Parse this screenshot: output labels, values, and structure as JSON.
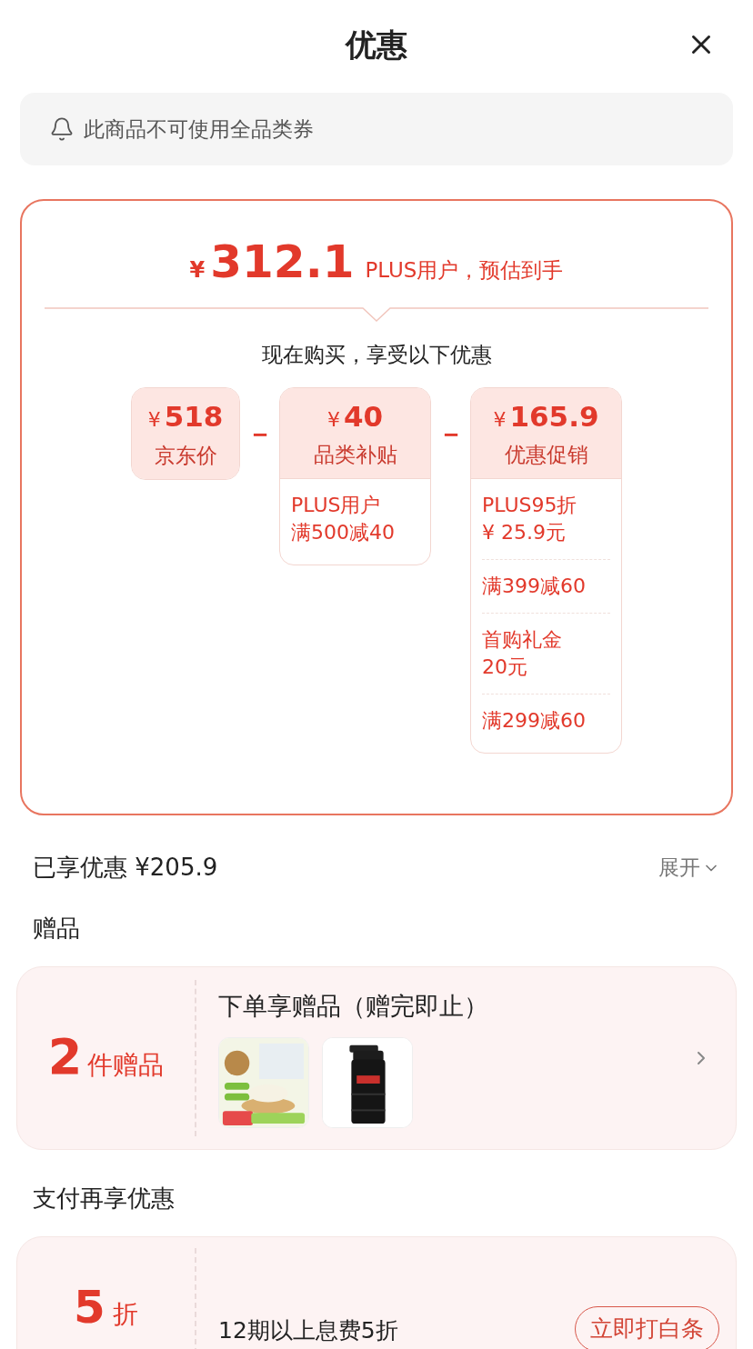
{
  "header": {
    "title": "优惠"
  },
  "notice": {
    "text": "此商品不可使用全品类券"
  },
  "estimate": {
    "currency": "¥",
    "amount": "312.1",
    "label": "PLUS用户，预估到手"
  },
  "subtitle": "现在购买，享受以下优惠",
  "breakdown": [
    {
      "currency": "¥",
      "amount": "518",
      "label": "京东价"
    },
    {
      "operator": "－",
      "currency": "¥",
      "amount": "40",
      "label": "品类补贴",
      "details": [
        {
          "lines": [
            "PLUS用户",
            "满500减40"
          ]
        }
      ]
    },
    {
      "operator": "－",
      "currency": "¥",
      "amount": "165.9",
      "label": "优惠促销",
      "details": [
        {
          "lines": [
            "PLUS95折",
            "¥ 25.9元"
          ]
        },
        {
          "lines": [
            "满399减60"
          ]
        },
        {
          "lines": [
            "首购礼金",
            "20元"
          ]
        },
        {
          "lines": [
            "满299减60"
          ]
        }
      ]
    }
  ],
  "savings": {
    "label": "已享优惠 ¥205.9",
    "toggle": "展开"
  },
  "gifts": {
    "heading": "赠品",
    "count": "2",
    "count_label": "件赠品",
    "title": "下单享赠品（赠完即止）"
  },
  "payment": {
    "heading": "支付再享优惠",
    "discount": "5",
    "discount_label": "折",
    "text": "12期以上息费5折",
    "button": "立即打白条"
  }
}
